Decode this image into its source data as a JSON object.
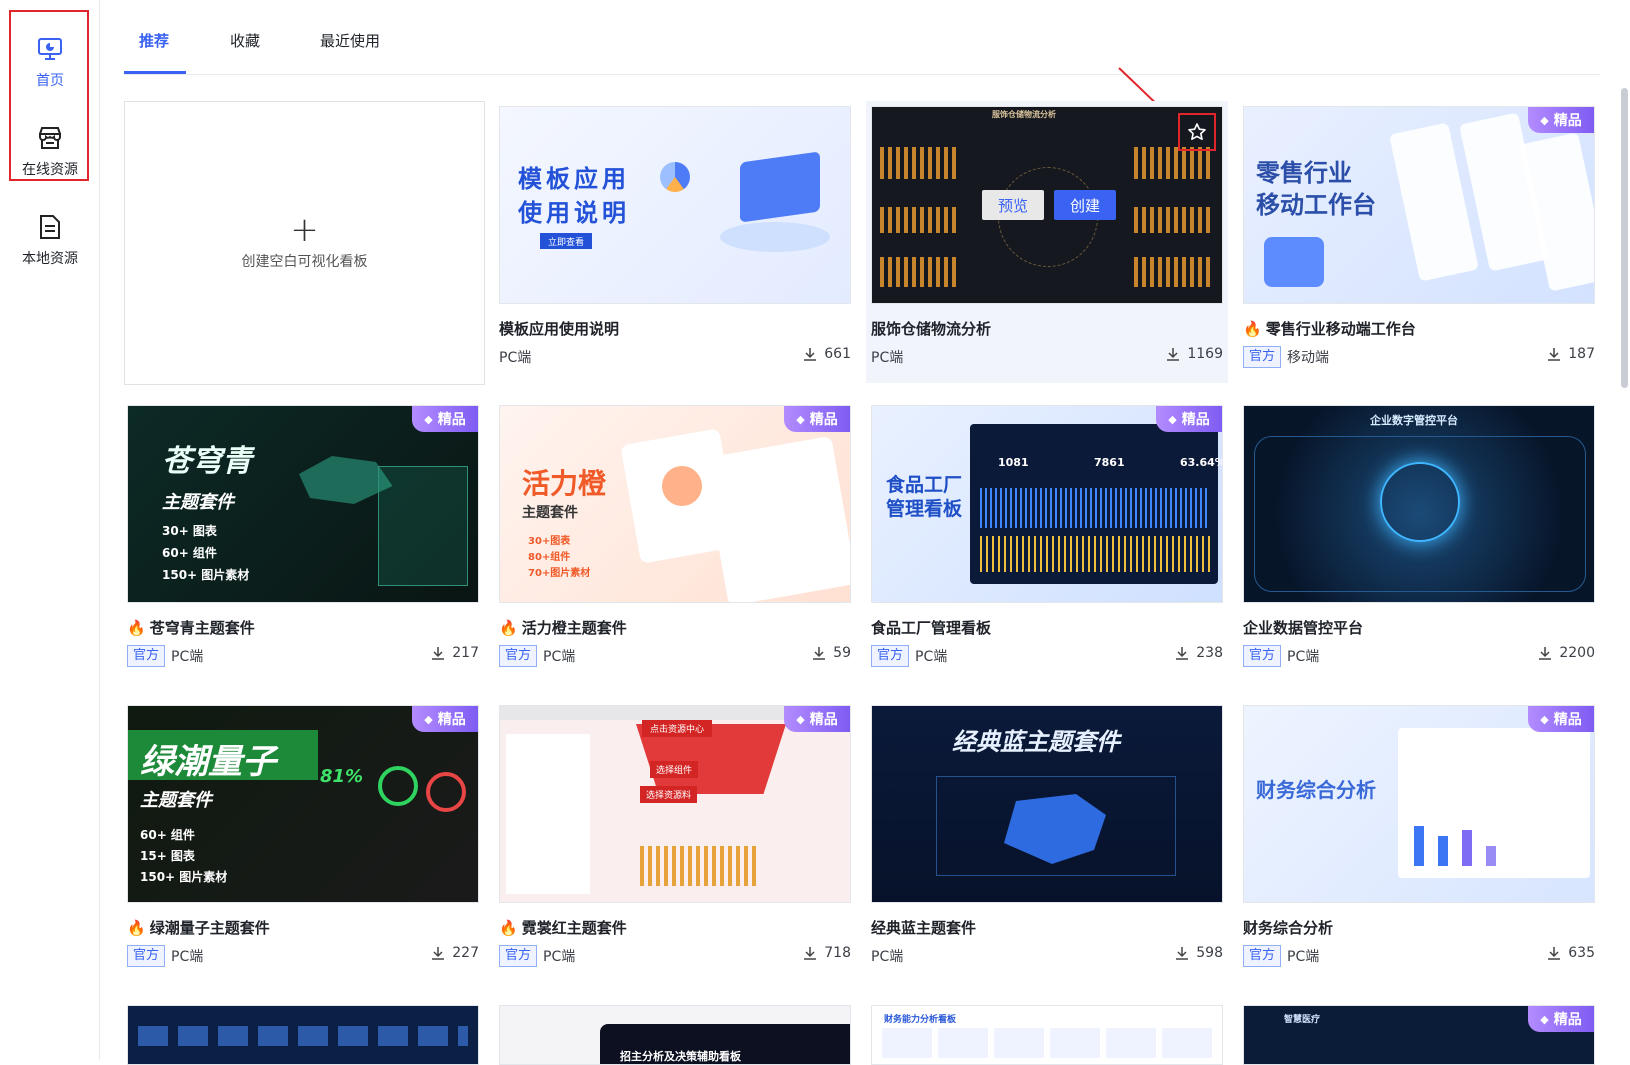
{
  "sidebar": {
    "items": [
      {
        "label": "首页",
        "icon": "dashboard-icon"
      },
      {
        "label": "在线资源",
        "icon": "store-icon"
      },
      {
        "label": "本地资源",
        "icon": "file-icon"
      }
    ]
  },
  "tabs": [
    {
      "label": "推荐"
    },
    {
      "label": "收藏"
    },
    {
      "label": "最近使用"
    }
  ],
  "blank": {
    "label": "创建空白可视化看板",
    "plus": "+"
  },
  "badge_label": "精品",
  "official_label": "官方",
  "hover_buttons": {
    "preview": "预览",
    "create": "创建"
  },
  "cards": [
    {
      "title": "模板应用使用说明",
      "platform": "PC端",
      "downloads": "661",
      "official": false,
      "hot": false,
      "thumb_text": [
        "模板应用",
        "使用说明",
        "立即查看"
      ]
    },
    {
      "title": "服饰仓储物流分析",
      "platform": "PC端",
      "downloads": "1169",
      "official": false,
      "hot": false,
      "thumb_text": [
        "服饰仓储物流分析"
      ]
    },
    {
      "title": "零售行业移动端工作台",
      "platform": "移动端",
      "downloads": "187",
      "official": true,
      "hot": true,
      "thumb_text": [
        "零售行业",
        "移动工作台"
      ]
    },
    {
      "title": "苍穹青主题套件",
      "platform": "PC端",
      "downloads": "217",
      "official": true,
      "hot": true,
      "thumb_text": [
        "苍穹青",
        "主题套件",
        "30+ 图表",
        "60+ 组件",
        "150+ 图片素材"
      ]
    },
    {
      "title": "活力橙主题套件",
      "platform": "PC端",
      "downloads": "59",
      "official": true,
      "hot": true,
      "thumb_text": [
        "活力橙",
        "主题套件",
        "30+图表",
        "80+组件",
        "70+图片素材"
      ]
    },
    {
      "title": "食品工厂管理看板",
      "platform": "PC端",
      "downloads": "238",
      "official": true,
      "hot": false,
      "thumb_text": [
        "食品工厂",
        "管理看板",
        "1081",
        "7861",
        "63.64%"
      ]
    },
    {
      "title": "企业数据管控平台",
      "platform": "PC端",
      "downloads": "2200",
      "official": true,
      "hot": false,
      "thumb_text": [
        "企业数字管控平台"
      ]
    },
    {
      "title": "绿潮量子主题套件",
      "platform": "PC端",
      "downloads": "227",
      "official": true,
      "hot": true,
      "thumb_text": [
        "绿潮量子",
        "主题套件",
        "60+ 组件",
        "15+ 图表",
        "150+ 图片素材",
        "81%"
      ]
    },
    {
      "title": "霓裳红主题套件",
      "platform": "PC端",
      "downloads": "718",
      "official": true,
      "hot": true,
      "thumb_text": [
        "点击资源中心",
        "选择组件",
        "选择资源料"
      ]
    },
    {
      "title": "经典蓝主题套件",
      "platform": "PC端",
      "downloads": "598",
      "official": false,
      "hot": false,
      "thumb_text": [
        "经典蓝主题套件"
      ]
    },
    {
      "title": "财务综合分析",
      "platform": "PC端",
      "downloads": "635",
      "official": true,
      "hot": false,
      "thumb_text": [
        "财务综合分析"
      ]
    }
  ],
  "partial_row_text": [
    "招主分析及决策辅助看板",
    "财务能力分析看板",
    "智慧医疗"
  ]
}
